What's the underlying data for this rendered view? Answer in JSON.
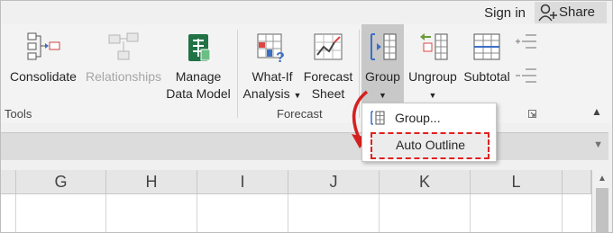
{
  "titlebar": {
    "signin": "Sign in",
    "share": "Share"
  },
  "ribbon": {
    "buttons": {
      "consolidate": "Consolidate",
      "relationships": "Relationships",
      "manage_line1": "Manage",
      "manage_line2": "Data Model",
      "whatif_line1": "What-If",
      "whatif_line2": "Analysis",
      "forecast_line1": "Forecast",
      "forecast_line2": "Sheet",
      "group": "Group",
      "ungroup": "Ungroup",
      "subtotal": "Subtotal"
    },
    "group_labels": {
      "tools": "Tools",
      "forecast": "Forecast"
    }
  },
  "dropdown": {
    "group_item": "Group...",
    "auto_outline_item": "Auto Outline"
  },
  "sheet": {
    "columns": [
      "G",
      "H",
      "I",
      "J",
      "K",
      "L"
    ]
  },
  "colors": {
    "highlight_border": "#e02020",
    "arrow": "#d42020",
    "excel_green": "#217346"
  }
}
